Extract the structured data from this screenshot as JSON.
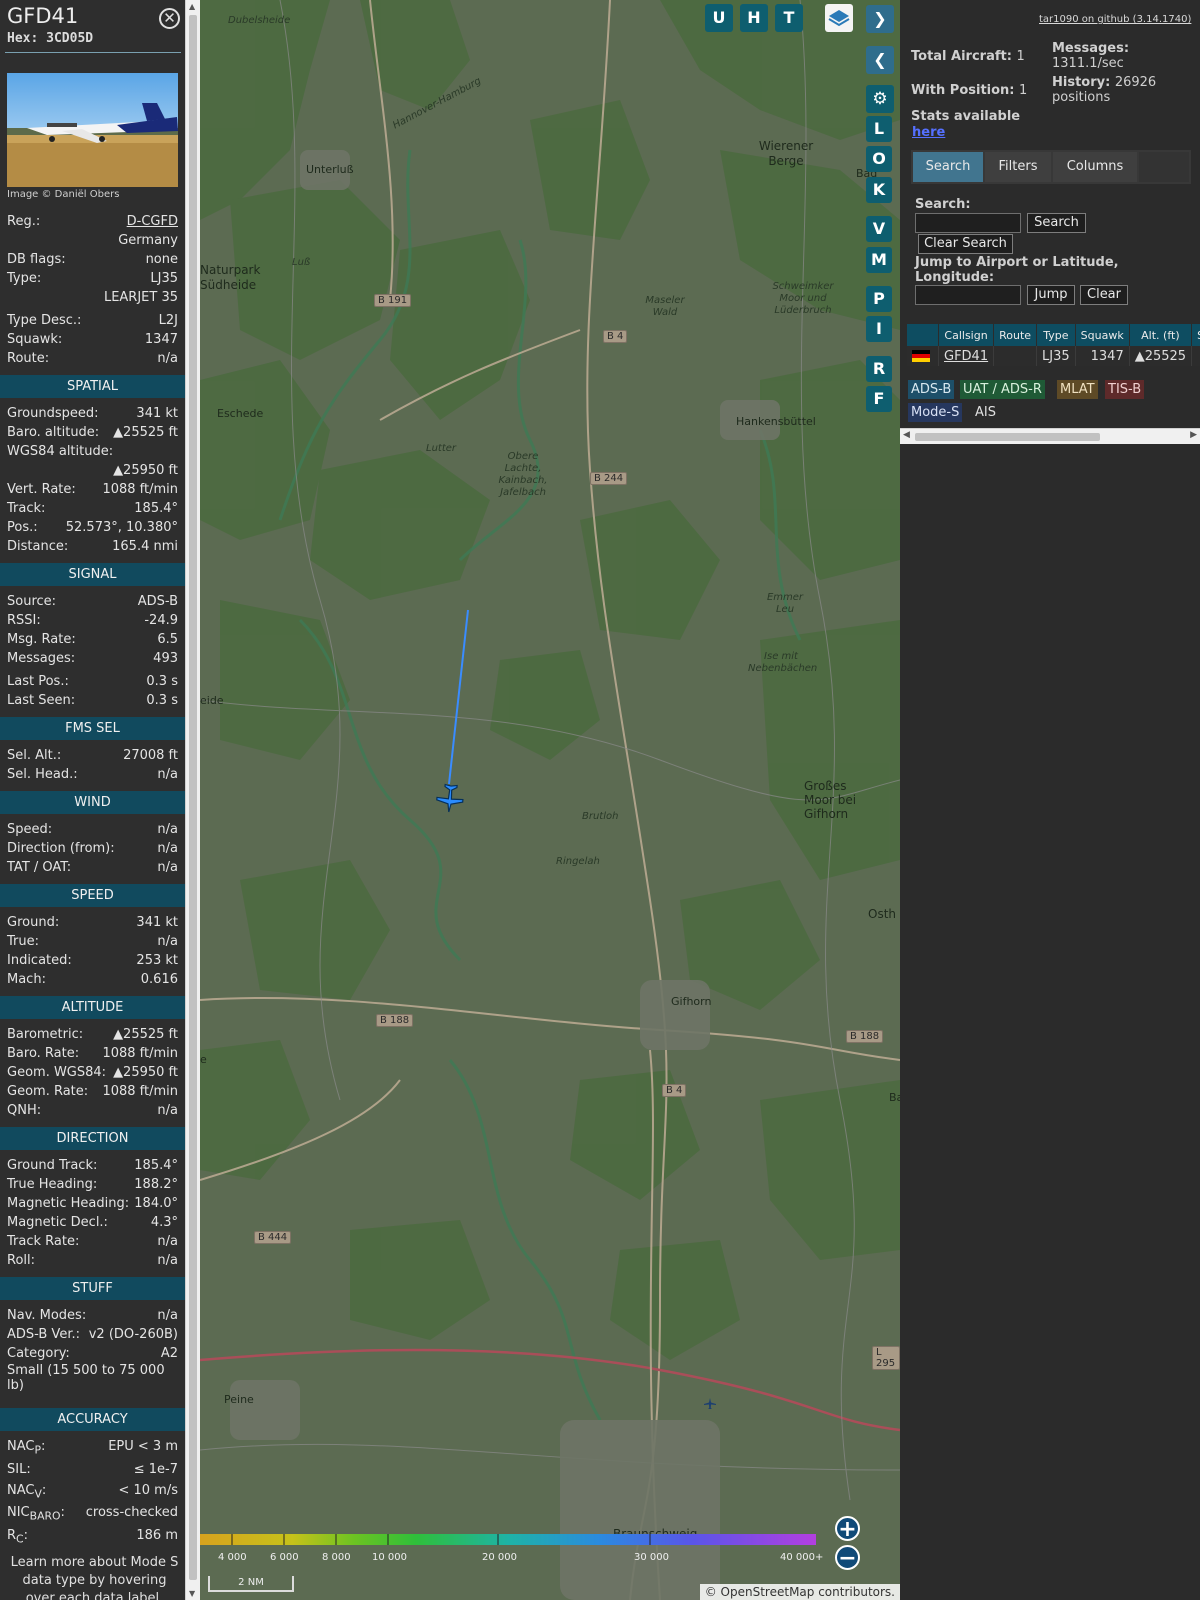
{
  "info": {
    "callsign": "GFD41",
    "hex": "Hex: 3CD05D",
    "photo_credit": "Image © Daniël Obers",
    "basic": [
      {
        "k": "Reg.:",
        "v": "D-CGFD"
      },
      {
        "k": "",
        "v": "Germany"
      },
      {
        "k": "DB flags:",
        "v": "none"
      },
      {
        "k": "Type:",
        "v": "LJ35"
      },
      {
        "k": "",
        "v": "LEARJET 35"
      },
      {
        "k": "Type Desc.:",
        "v": "L2J"
      },
      {
        "k": "Squawk:",
        "v": "1347"
      },
      {
        "k": "Route:",
        "v": "n/a"
      }
    ],
    "sections": {
      "spatial": "SPATIAL",
      "signal": "SIGNAL",
      "fms": "FMS SEL",
      "wind": "WIND",
      "speed": "SPEED",
      "altitude": "ALTITUDE",
      "direction": "DIRECTION",
      "stuff": "STUFF",
      "accuracy": "ACCURACY"
    },
    "spatial": [
      {
        "k": "Groundspeed:",
        "v": "341 kt"
      },
      {
        "k": "Baro. altitude:",
        "v": "▲25525 ft"
      },
      {
        "k": "WGS84 altitude:",
        "v": ""
      },
      {
        "k": "",
        "v": "▲25950 ft"
      },
      {
        "k": "Vert. Rate:",
        "v": "1088 ft/min"
      },
      {
        "k": "Track:",
        "v": "185.4°"
      },
      {
        "k": "Pos.:",
        "v": "52.573°, 10.380°"
      },
      {
        "k": "Distance:",
        "v": "165.4 nmi"
      }
    ],
    "signal": [
      {
        "k": "Source:",
        "v": "ADS-B"
      },
      {
        "k": "RSSI:",
        "v": "-24.9"
      },
      {
        "k": "Msg. Rate:",
        "v": "6.5"
      },
      {
        "k": "Messages:",
        "v": "493"
      },
      {
        "k": "Last Pos.:",
        "v": "0.3 s"
      },
      {
        "k": "Last Seen:",
        "v": "0.3 s"
      }
    ],
    "fms": [
      {
        "k": "Sel. Alt.:",
        "v": "27008 ft"
      },
      {
        "k": "Sel. Head.:",
        "v": "n/a"
      }
    ],
    "wind": [
      {
        "k": "Speed:",
        "v": "n/a"
      },
      {
        "k": "Direction (from):",
        "v": "n/a"
      },
      {
        "k": "TAT / OAT:",
        "v": "n/a"
      }
    ],
    "speed": [
      {
        "k": "Ground:",
        "v": "341 kt"
      },
      {
        "k": "True:",
        "v": "n/a"
      },
      {
        "k": "Indicated:",
        "v": "253 kt"
      },
      {
        "k": "Mach:",
        "v": "0.616"
      }
    ],
    "altitude": [
      {
        "k": "Barometric:",
        "v": "▲25525 ft"
      },
      {
        "k": "Baro. Rate:",
        "v": "1088 ft/min"
      },
      {
        "k": "Geom. WGS84:",
        "v": "▲25950 ft"
      },
      {
        "k": "Geom. Rate:",
        "v": "1088 ft/min"
      },
      {
        "k": "QNH:",
        "v": "n/a"
      }
    ],
    "direction": [
      {
        "k": "Ground Track:",
        "v": "185.4°"
      },
      {
        "k": "True Heading:",
        "v": "188.2°"
      },
      {
        "k": "Magnetic Heading:",
        "v": "184.0°"
      },
      {
        "k": "Magnetic Decl.:",
        "v": "4.3°"
      },
      {
        "k": "Track Rate:",
        "v": "n/a"
      },
      {
        "k": "Roll:",
        "v": "n/a"
      }
    ],
    "stuff": [
      {
        "k": "Nav. Modes:",
        "v": "n/a"
      },
      {
        "k": "ADS-B Ver.:",
        "v": "v2 (DO-260B)"
      },
      {
        "k": "Category:",
        "v": "A2"
      }
    ],
    "category_desc": "Small (15 500 to 75 000 lb)",
    "accuracy": {
      "nacp": {
        "k": "NAC",
        "sub": "P",
        "v": "EPU < 3 m"
      },
      "sil": {
        "k": "SIL:",
        "v": "≤ 1e-7"
      },
      "nacv": {
        "k": "NAC",
        "sub": "V",
        "v": "< 10 m/s"
      },
      "nicbaro": {
        "k": "NIC",
        "sub": "BARO",
        "v": "cross-checked"
      },
      "rc": {
        "k": "R",
        "sub": "C",
        "v": "186 m"
      }
    },
    "footer": "Learn more about Mode S data type by hovering over each data label."
  },
  "map": {
    "buttons_top": [
      "U",
      "H",
      "T"
    ],
    "buttons_side": [
      "L",
      "O",
      "K",
      "V",
      "M",
      "P",
      "I",
      "R",
      "F"
    ],
    "labels": [
      {
        "t": "Dubelsheide",
        "cls": "ital"
      },
      {
        "t": "Unterluß",
        "cls": ""
      },
      {
        "t": "Naturpark Südheide",
        "cls": "big"
      },
      {
        "t": "Luß",
        "cls": "ital"
      },
      {
        "t": "Wierener Berge",
        "cls": "big"
      },
      {
        "t": "Bad",
        "cls": ""
      },
      {
        "t": "Schweimker Moor und Lüderbruch",
        "cls": "ital"
      },
      {
        "t": "Maseler Wald",
        "cls": "ital"
      },
      {
        "t": "Eschede",
        "cls": ""
      },
      {
        "t": "Hankensbüttel",
        "cls": ""
      },
      {
        "t": "Lutter",
        "cls": "ital"
      },
      {
        "t": "Obere Lachte, Kainbach, Jafelbach",
        "cls": "ital"
      },
      {
        "t": "Emmer Leu",
        "cls": "ital"
      },
      {
        "t": "Ise mit Nebenbächen",
        "cls": "ital"
      },
      {
        "t": "eide",
        "cls": ""
      },
      {
        "t": "Großes Moor bei Gifhorn",
        "cls": "big"
      },
      {
        "t": "Brutloh",
        "cls": "ital"
      },
      {
        "t": "Ringelah",
        "cls": "ital"
      },
      {
        "t": "Osth",
        "cls": "big"
      },
      {
        "t": "Gifhorn",
        "cls": ""
      },
      {
        "t": "e",
        "cls": ""
      },
      {
        "t": "Ba",
        "cls": ""
      },
      {
        "t": "Peine",
        "cls": ""
      },
      {
        "t": "Braunschweig",
        "cls": "big"
      },
      {
        "t": "Hannover-Hamburg",
        "cls": "ital"
      }
    ],
    "roads": [
      "B 191",
      "B 4",
      "B 244",
      "B 188",
      "B 4",
      "B 188",
      "B 444",
      "L 295"
    ],
    "altitude_scale": [
      "4 000",
      "6 000",
      "8 000",
      "10 000",
      "20 000",
      "30 000",
      "40 000+"
    ],
    "scale": "2 NM",
    "attribution": "© OpenStreetMap contributors."
  },
  "sidebar": {
    "version": "tar1090 on github (3.14.1740)",
    "total_label": "Total Aircraft:",
    "total_value": "1",
    "pos_label": "With Position:",
    "pos_value": "1",
    "msg_label": "Messages:",
    "msg_value": "1311.1/sec",
    "hist_label": "History:",
    "hist_value": "26926 positions",
    "stats_label": "Stats available",
    "stats_link": "here",
    "tabs": [
      "Search",
      "Filters",
      "Columns"
    ],
    "search_label": "Search:",
    "search_button": "Search",
    "clear_search": "Clear Search",
    "jump_label": "Jump to Airport or Latitude, Longitude:",
    "jump_button": "Jump",
    "clear_button": "Clear",
    "columns": [
      "",
      "Callsign",
      "Route",
      "Type",
      "Squawk",
      "Alt. (ft)",
      "Spd"
    ],
    "row": {
      "callsign": "GFD41",
      "route": "",
      "type": "LJ35",
      "squawk": "1347",
      "alt": "▲25525",
      "spd": ""
    },
    "legend": [
      "ADS-B",
      "UAT / ADS-R",
      "MLAT",
      "TIS-B",
      "Mode-S",
      "AIS"
    ]
  },
  "colors": {
    "header_teal": "#114a5e",
    "map_button": "#0e5e6f",
    "track_line": "#3a8cff",
    "aircraft": "#2a8cff"
  }
}
